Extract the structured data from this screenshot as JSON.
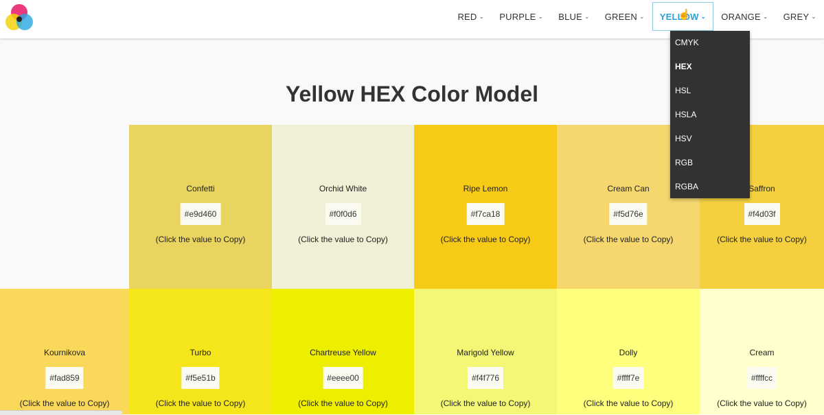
{
  "nav": {
    "items": [
      {
        "label": "RED"
      },
      {
        "label": "PURPLE"
      },
      {
        "label": "BLUE"
      },
      {
        "label": "GREEN"
      },
      {
        "label": "YELLOW",
        "active": true
      },
      {
        "label": "ORANGE"
      },
      {
        "label": "GREY"
      }
    ],
    "dropdown": [
      "CMYK",
      "HEX",
      "HSL",
      "HSLA",
      "HSV",
      "RGB",
      "RGBA"
    ],
    "dropdown_selected": "HEX",
    "accent": "#2aa0d8"
  },
  "page": {
    "title": "Yellow HEX Color Model"
  },
  "copy_hint": "(Click the value to Copy)",
  "rows": [
    [
      {
        "name": "Confetti",
        "hex": "#e9d460",
        "copy": "(Click the value to Copy)"
      },
      {
        "name": "Orchid White",
        "hex": "#f0f0d6",
        "copy": "(Click the value to Copy)"
      },
      {
        "name": "Ripe Lemon",
        "hex": "#f7ca18",
        "copy": "(Click the value to Copy)"
      },
      {
        "name": "Cream Can",
        "hex": "#f5d76e",
        "copy": "(Click the value to Copy)"
      },
      {
        "name": "Saffron",
        "hex": "#f4d03f",
        "copy": "(Click the value to Copy)"
      }
    ],
    [
      {
        "name": "Kournikova",
        "hex": "#fad859",
        "copy": "(Click the value to Copy)"
      },
      {
        "name": "Turbo",
        "hex": "#f5e51b",
        "copy": "(Click the value to Copy)"
      },
      {
        "name": "Chartreuse Yellow",
        "hex": "#eeee00",
        "copy": "(Click the value to Copy)"
      },
      {
        "name": "Marigold Yellow",
        "hex": "#f4f776",
        "copy": "(Click the value to Copy)"
      },
      {
        "name": "Dolly",
        "hex": "#ffff7e",
        "copy": "(Click the value to Copy)"
      },
      {
        "name": "Cream",
        "hex": "#ffffcc",
        "copy": "(Click the value to Copy)"
      }
    ]
  ]
}
